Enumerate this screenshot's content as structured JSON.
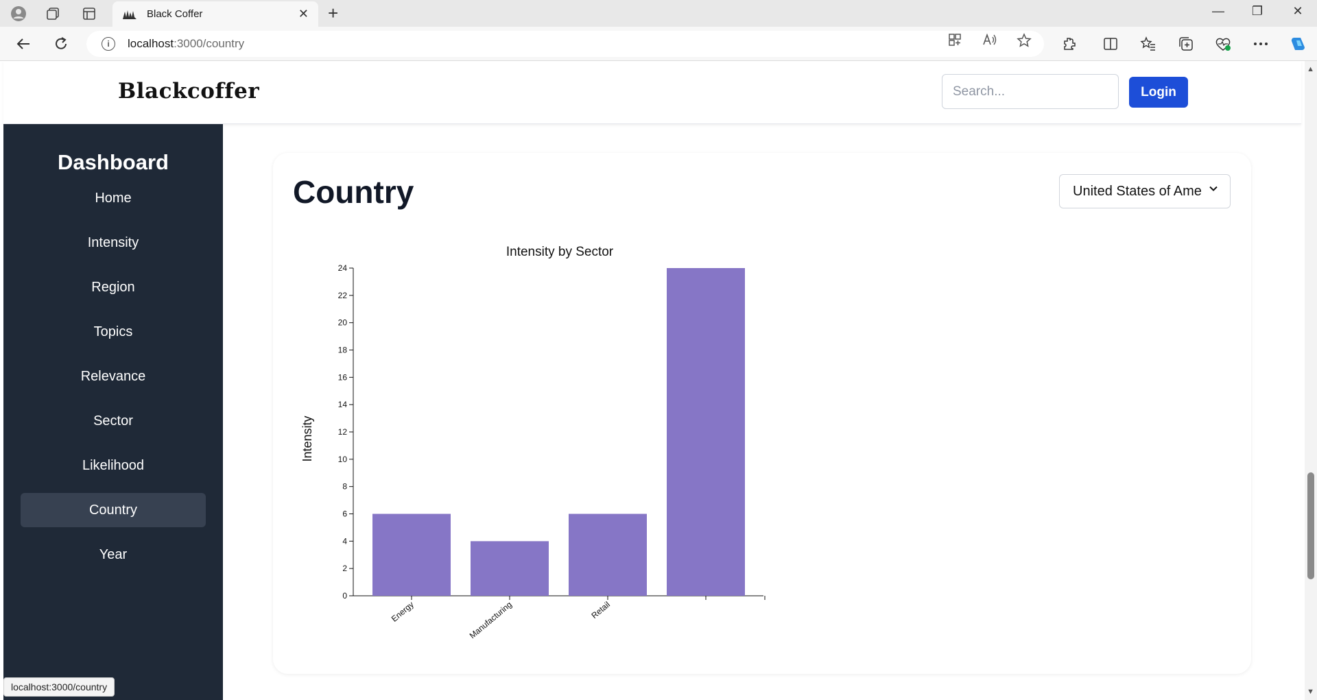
{
  "browser": {
    "tab_title": "Black Coffer",
    "url_host": "localhost",
    "url_path": ":3000/country",
    "status_url": "localhost:3000/country"
  },
  "header": {
    "brand": "Blackcoffer",
    "search_placeholder": "Search...",
    "login_label": "Login"
  },
  "sidebar": {
    "title": "Dashboard",
    "items": [
      {
        "label": "Home",
        "active": false
      },
      {
        "label": "Intensity",
        "active": false
      },
      {
        "label": "Region",
        "active": false
      },
      {
        "label": "Topics",
        "active": false
      },
      {
        "label": "Relevance",
        "active": false
      },
      {
        "label": "Sector",
        "active": false
      },
      {
        "label": "Likelihood",
        "active": false
      },
      {
        "label": "Country",
        "active": true
      },
      {
        "label": "Year",
        "active": false
      }
    ]
  },
  "main": {
    "title": "Country",
    "country_select_value": "United States of America"
  },
  "colors": {
    "sidebar_bg": "#1f2937",
    "sidebar_active": "#374151",
    "login_bg": "#1d4ed8",
    "bar_fill": "#8676c6"
  },
  "chart_data": {
    "type": "bar",
    "title": "Intensity by Sector",
    "xlabel": "",
    "ylabel": "Intensity",
    "categories": [
      "Energy",
      "Manufacturing",
      "Retail",
      ""
    ],
    "values": [
      6,
      4,
      6,
      24
    ],
    "ylim": [
      0,
      24
    ],
    "yticks": [
      0,
      2,
      4,
      6,
      8,
      10,
      12,
      14,
      16,
      18,
      20,
      22,
      24
    ],
    "grid": false,
    "legend": "none"
  }
}
